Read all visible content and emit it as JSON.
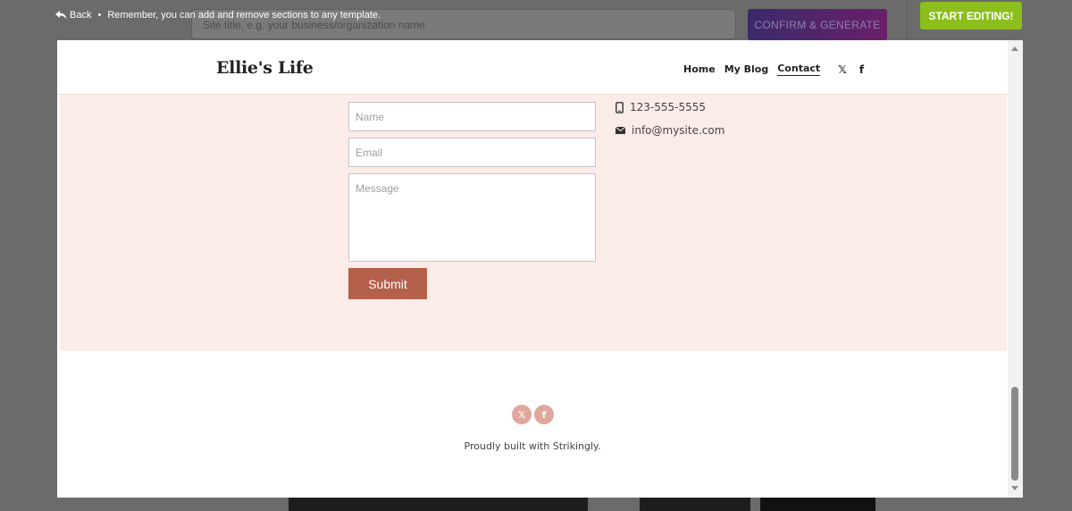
{
  "background": {
    "site_title_placeholder": "Site title, e.g. your business/organization name",
    "confirm_label": "CONFIRM & GENERATE"
  },
  "topbar": {
    "back_label": "Back",
    "separator": "•",
    "message": "Remember, you can add and remove sections to any template.",
    "start_editing_label": "START EDITING!"
  },
  "site": {
    "logo": "Ellie's Life",
    "nav": [
      "Home",
      "My Blog",
      "Contact"
    ],
    "social_icons": [
      "x-icon",
      "facebook-icon"
    ],
    "social_glyphs": [
      "𝕏",
      "f"
    ]
  },
  "contact": {
    "name_placeholder": "Name",
    "email_placeholder": "Email",
    "message_placeholder": "Message",
    "submit_label": "Submit",
    "phone": "123-555-5555",
    "email": "info@mysite.com"
  },
  "footer": {
    "built_with": "Proudly built with Strikingly."
  },
  "colors": {
    "start_button": "#8cbe1e",
    "submit_button": "#b5604a",
    "section_bg": "#fcece8",
    "footer_social": "#dfa89d"
  }
}
